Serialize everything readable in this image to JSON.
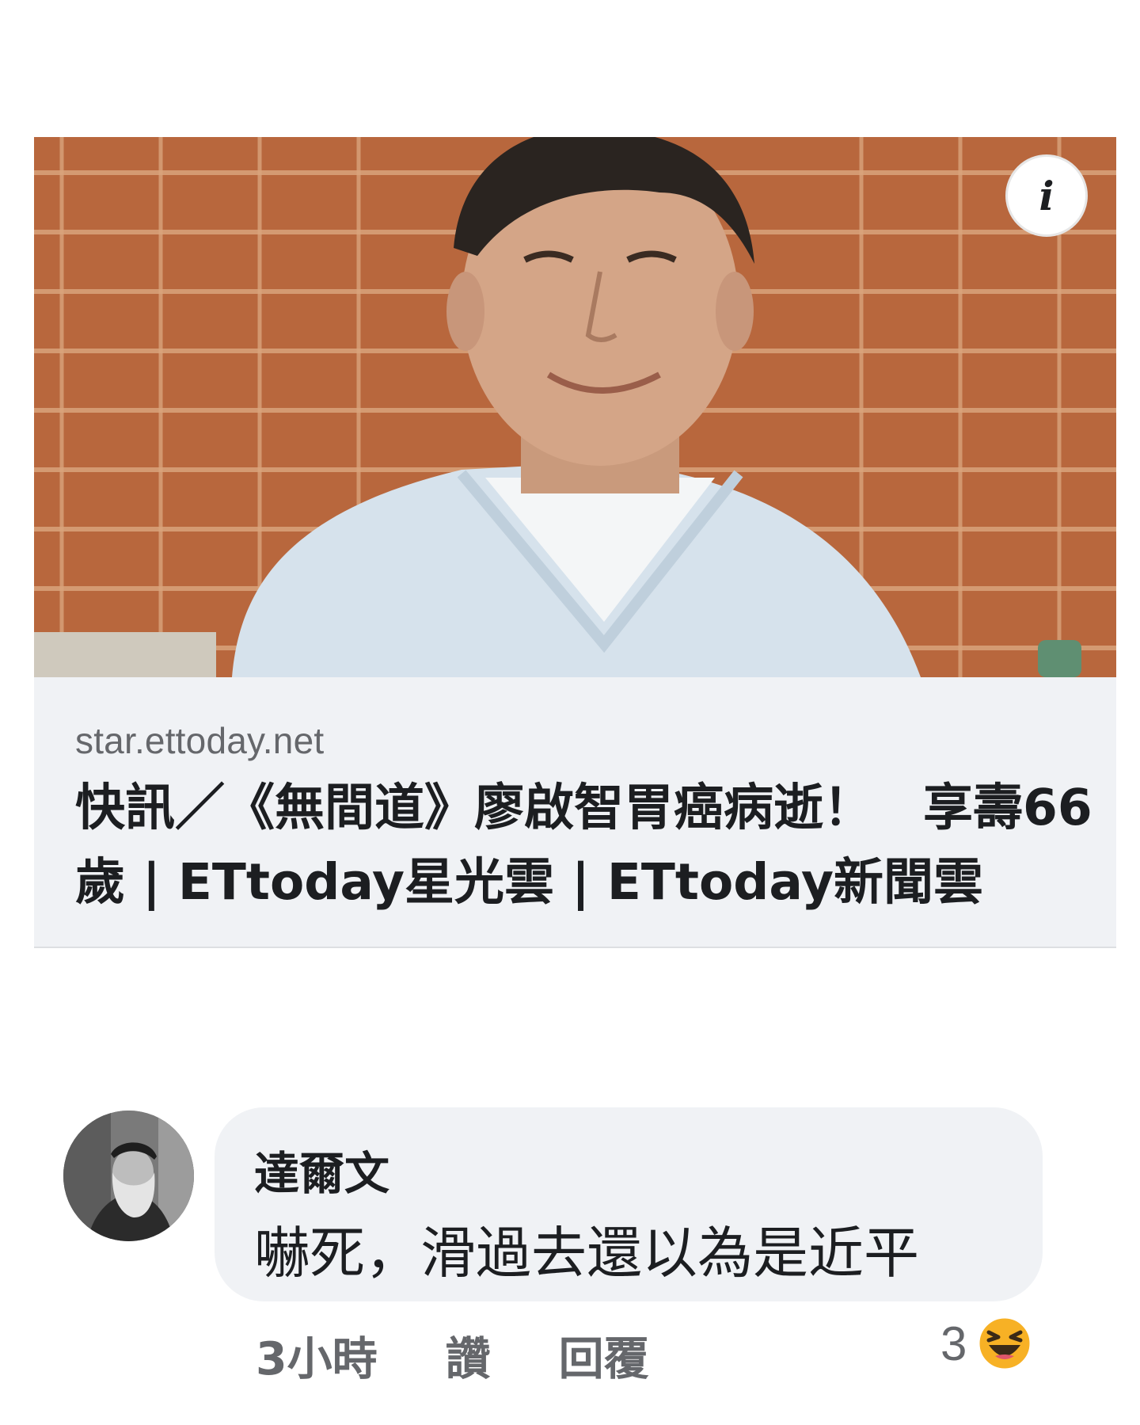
{
  "link_preview": {
    "domain": "star.ettoday.net",
    "title": "快訊／《無間道》廖啟智胃癌病逝！　享壽66歲 | ETtoday星光雲 | ETtoday新聞雲",
    "info_glyph": "i",
    "image": "photo-of-smiling-man-in-light-blue-sweater-before-brick-wall",
    "colors": {
      "card_bg": "#f0f2f5",
      "domain_text": "#65676b",
      "title_text": "#1c1e21"
    }
  },
  "comment": {
    "author": "達爾文",
    "text": "嚇死，滑過去還以為是近平",
    "avatar": "bearded-man-avatar",
    "actions": {
      "time": "3小時",
      "like": "讚",
      "reply": "回覆"
    },
    "reaction": {
      "count": "3",
      "icon": "haha-laughing-emoji-icon"
    },
    "colors": {
      "bubble_bg": "#f0f2f5",
      "meta_text": "#65676b",
      "emoji": "#f7b125"
    }
  }
}
